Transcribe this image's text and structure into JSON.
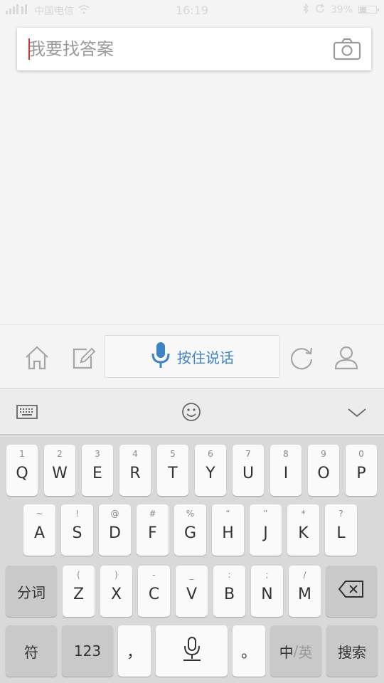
{
  "status_bar": {
    "carrier": "中国电信",
    "time": "16:19",
    "battery_text": "39%",
    "battery_level": 0.39
  },
  "search": {
    "placeholder": "我要找答案",
    "value": ""
  },
  "icons": {
    "camera": "camera-icon",
    "home": "home-icon",
    "edit": "edit-icon",
    "mic": "mic-icon",
    "refresh": "refresh-icon",
    "profile": "profile-icon",
    "keyboard": "keyboard-icon",
    "emoji": "emoji-icon",
    "collapse": "chevron-down-icon",
    "backspace": "backspace-icon"
  },
  "app_bar": {
    "voice_label": "按住说话"
  },
  "keyboard": {
    "row1": [
      {
        "hint": "1",
        "label": "Q"
      },
      {
        "hint": "2",
        "label": "W"
      },
      {
        "hint": "3",
        "label": "E"
      },
      {
        "hint": "4",
        "label": "R"
      },
      {
        "hint": "5",
        "label": "T"
      },
      {
        "hint": "6",
        "label": "Y"
      },
      {
        "hint": "7",
        "label": "U"
      },
      {
        "hint": "8",
        "label": "I"
      },
      {
        "hint": "9",
        "label": "O"
      },
      {
        "hint": "0",
        "label": "P"
      }
    ],
    "row2": [
      {
        "hint": "~",
        "label": "A"
      },
      {
        "hint": "!",
        "label": "S"
      },
      {
        "hint": "@",
        "label": "D"
      },
      {
        "hint": "#",
        "label": "F"
      },
      {
        "hint": "%",
        "label": "G"
      },
      {
        "hint": "“",
        "label": "H"
      },
      {
        "hint": "”",
        "label": "J"
      },
      {
        "hint": "*",
        "label": "K"
      },
      {
        "hint": "?",
        "label": "L"
      }
    ],
    "row3": [
      {
        "hint": "(",
        "label": "Z"
      },
      {
        "hint": ")",
        "label": "X"
      },
      {
        "hint": "-",
        "label": "C"
      },
      {
        "hint": "_",
        "label": "V"
      },
      {
        "hint": ":",
        "label": "B"
      },
      {
        "hint": ";",
        "label": "N"
      },
      {
        "hint": "/",
        "label": "M"
      }
    ],
    "fenci": "分词",
    "fu": "符",
    "num": "123",
    "comma": "，",
    "period": "。",
    "lang_zh": "中",
    "lang_sep": "/",
    "lang_en": "英",
    "search": "搜索"
  },
  "colors": {
    "accent": "#3d84c5",
    "caret": "#d03a2f"
  }
}
